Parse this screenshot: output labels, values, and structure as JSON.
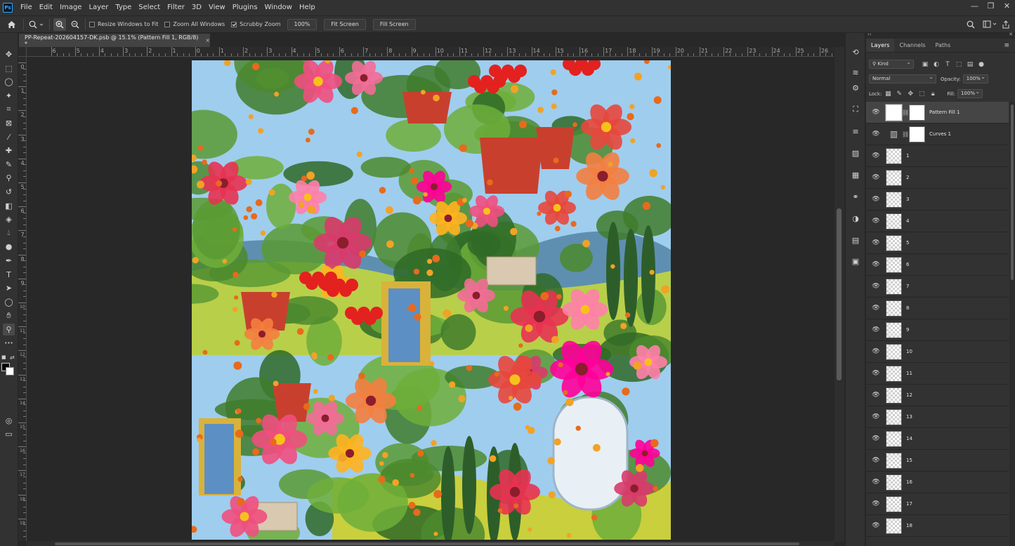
{
  "app": {
    "logo": "Ps",
    "menu": [
      "File",
      "Edit",
      "Image",
      "Layer",
      "Type",
      "Select",
      "Filter",
      "3D",
      "View",
      "Plugins",
      "Window",
      "Help"
    ],
    "window_controls": [
      "—",
      "❐",
      "✕"
    ]
  },
  "options_bar": {
    "home_icon": "home-icon",
    "zoom_tool_icon": "zoom-icon",
    "resize_windows_label": "Resize Windows to Fit",
    "resize_windows_checked": false,
    "zoom_all_label": "Zoom All Windows",
    "zoom_all_checked": false,
    "scrubby_label": "Scrubby Zoom",
    "scrubby_checked": true,
    "percent_button": "100%",
    "fit_screen_button": "Fit Screen",
    "fill_screen_button": "Fill Screen"
  },
  "document": {
    "tab_title": "PP-Repeat-202604157-DK.psb @ 15.1% (Pattern Fill 1, RGB/8) *",
    "close_symbol": "×"
  },
  "rulers": {
    "top_labels": [
      "6",
      "5",
      "4",
      "3",
      "2",
      "1",
      "0",
      "1",
      "2",
      "3",
      "4",
      "5",
      "6",
      "7",
      "8",
      "9",
      "10",
      "11",
      "12",
      "13",
      "14",
      "15",
      "16",
      "17",
      "18",
      "19",
      "20",
      "21",
      "22",
      "23",
      "24",
      "25",
      "26"
    ],
    "left_labels": [
      "0",
      "1",
      "2",
      "3",
      "4",
      "5",
      "6",
      "7",
      "8",
      "9",
      "10",
      "11",
      "12",
      "13",
      "14",
      "15",
      "16",
      "17",
      "18",
      "19"
    ]
  },
  "layers_panel": {
    "tabs": [
      "Layers",
      "Channels",
      "Paths"
    ],
    "active_tab": "Layers",
    "filter_kind": "Kind",
    "blend_mode": "Normal",
    "opacity_label": "Opacity:",
    "opacity_value": "100%",
    "lock_label": "Lock:",
    "fill_label": "Fill:",
    "fill_value": "100%",
    "layers": [
      {
        "name": "Pattern Fill 1",
        "type": "fill",
        "selected": true
      },
      {
        "name": "Curves 1",
        "type": "adjustment",
        "selected": false
      },
      {
        "name": "1",
        "type": "pixel"
      },
      {
        "name": "2",
        "type": "pixel"
      },
      {
        "name": "3",
        "type": "pixel"
      },
      {
        "name": "4",
        "type": "pixel"
      },
      {
        "name": "5",
        "type": "pixel"
      },
      {
        "name": "6",
        "type": "pixel"
      },
      {
        "name": "7",
        "type": "pixel"
      },
      {
        "name": "8",
        "type": "pixel"
      },
      {
        "name": "9",
        "type": "pixel"
      },
      {
        "name": "10",
        "type": "pixel"
      },
      {
        "name": "11",
        "type": "pixel"
      },
      {
        "name": "12",
        "type": "pixel"
      },
      {
        "name": "13",
        "type": "pixel"
      },
      {
        "name": "14",
        "type": "pixel"
      },
      {
        "name": "15",
        "type": "pixel"
      },
      {
        "name": "16",
        "type": "pixel"
      },
      {
        "name": "17",
        "type": "pixel"
      },
      {
        "name": "18",
        "type": "pixel"
      }
    ]
  },
  "colors": {
    "ui_bg": "#323232",
    "canvas_bg": "#282828",
    "selected_layer": "#454545",
    "accent": "#31a8ff"
  }
}
